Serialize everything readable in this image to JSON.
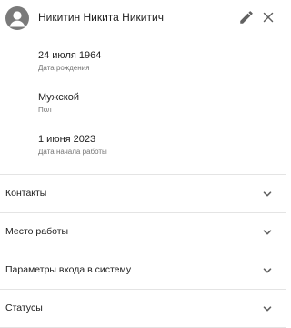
{
  "person": {
    "full_name": "Никитин Никита Никитич"
  },
  "icons": {
    "avatar": "account-circle-icon",
    "edit": "pencil-icon",
    "close": "close-icon",
    "chevron": "chevron-down-icon"
  },
  "fields": [
    {
      "value": "24 июля 1964",
      "label": "Дата рождения"
    },
    {
      "value": "Мужской",
      "label": "Пол"
    },
    {
      "value": "1 июня 2023",
      "label": "Дата начала работы"
    }
  ],
  "sections": [
    {
      "title": "Контакты"
    },
    {
      "title": "Место работы"
    },
    {
      "title": "Параметры входа в систему"
    },
    {
      "title": "Статусы"
    }
  ],
  "colors": {
    "avatar": "#7a7a7a",
    "icon": "#616161",
    "divider": "#e4e4e4",
    "secondary_text": "#757575"
  }
}
